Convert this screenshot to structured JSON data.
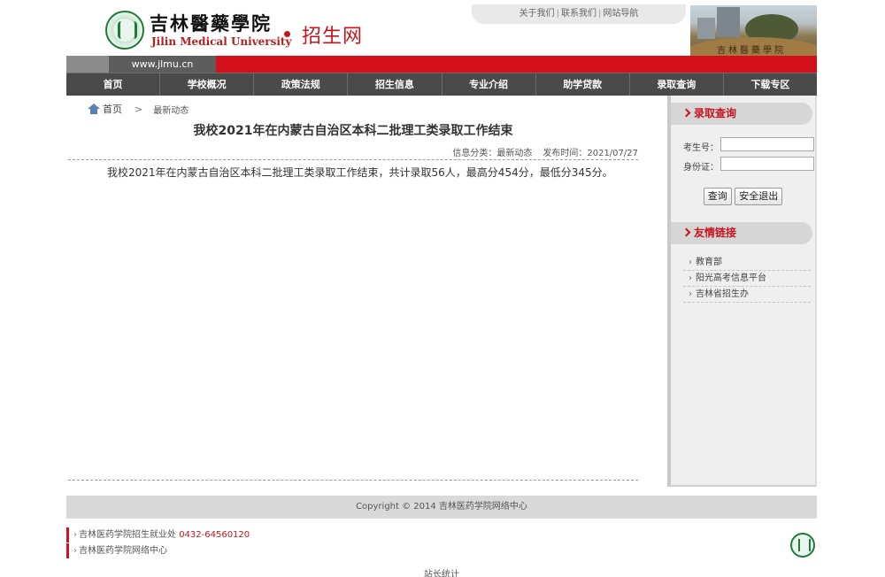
{
  "header": {
    "logo_cn": "吉林醫藥學院",
    "logo_en": "Jilin Medical University",
    "site_name": "招生网",
    "top_links": [
      "关于我们",
      "联系我们",
      "网站导航"
    ],
    "photo_caption": "吉林醫藥學院"
  },
  "url_bar": {
    "url": "www.jlmu.cn"
  },
  "nav": [
    {
      "label": "首页"
    },
    {
      "label": "学校概况"
    },
    {
      "label": "政策法规"
    },
    {
      "label": "招生信息"
    },
    {
      "label": "专业介绍"
    },
    {
      "label": "助学贷款"
    },
    {
      "label": "录取查询"
    },
    {
      "label": "下载专区"
    }
  ],
  "breadcrumb": {
    "home": "首页",
    "arrow": ">",
    "current": "最新动态"
  },
  "article": {
    "title": "我校2021年在内蒙古自治区本科二批理工类录取工作结束",
    "category_label": "信息分类：最新动态",
    "date_label": "发布时间：2021/07/27",
    "body": "我校2021年在内蒙古自治区本科二批理工类录取工作结束，共计录取56人，最高分454分，最低分345分。"
  },
  "sidebar": {
    "admission_query": {
      "title": "录取查询",
      "exam_no_label": "考生号：",
      "exam_no_value": "",
      "id_label": "身份证：",
      "id_value": "",
      "query_button": "查询",
      "logout_button": "安全退出"
    },
    "friend_links": {
      "title": "友情链接",
      "items": [
        "教育部",
        "阳光高考信息平台",
        "吉林省招生办"
      ]
    }
  },
  "footer": {
    "copyright": "Copyright © 2014 吉林医药学院网络中心",
    "line1_text": "吉林医药学院招生就业处",
    "line1_phone": "0432-64560120",
    "line2_text": "吉林医药学院网络中心",
    "stats": "站长统计"
  }
}
